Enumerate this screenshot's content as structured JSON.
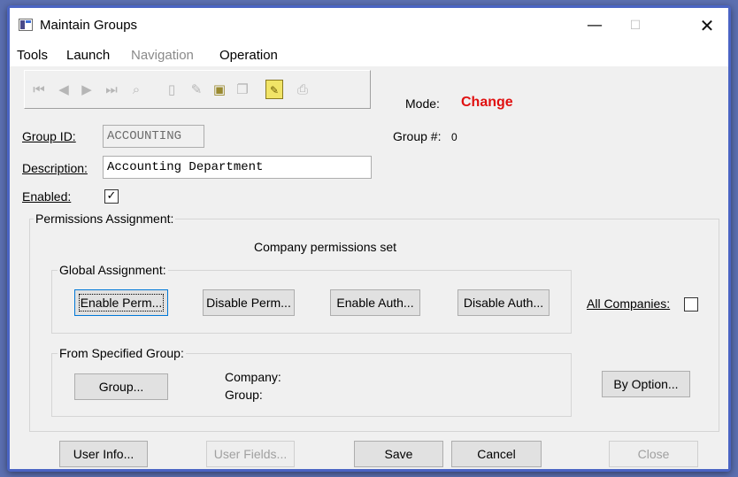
{
  "window": {
    "title": "Maintain Groups",
    "minimize_glyph": "—",
    "maximize_glyph": "☐",
    "close_glyph": "✕"
  },
  "menu": {
    "items": [
      "Tools",
      "Launch",
      "Navigation",
      "Operation"
    ]
  },
  "toolbar": {
    "icons": [
      "first-record",
      "previous-record",
      "next-record",
      "last-record",
      "find",
      "new-record",
      "delete-record",
      "undo",
      "copy",
      "notes",
      "print"
    ]
  },
  "mode": {
    "label": "Mode:",
    "value": "Change",
    "color": "#e01010"
  },
  "form": {
    "group_id_label": "Group ID:",
    "group_id_value": "ACCOUNTING",
    "group_number_label": "Group #:",
    "group_number_value": "0",
    "description_label": "Description:",
    "description_value": "Accounting Department",
    "enabled_label": "Enabled:",
    "enabled_checked": true,
    "enabled_mark": "✓"
  },
  "permissions": {
    "label": "Permissions Assignment:",
    "status_text": "Company permissions set",
    "global": {
      "label": "Global Assignment:",
      "buttons": [
        "Enable Perm...",
        "Disable Perm...",
        "Enable Auth...",
        "Disable Auth..."
      ]
    },
    "all_companies_label": "All Companies:",
    "all_companies_checked": false,
    "specified": {
      "label": "From Specified Group:",
      "group_button": "Group...",
      "company_label": "Company:",
      "group_label": "Group:"
    },
    "by_option_button": "By Option..."
  },
  "footer": {
    "user_info": "User Info...",
    "user_fields": "User Fields...",
    "save": "Save",
    "cancel": "Cancel",
    "close": "Close"
  }
}
